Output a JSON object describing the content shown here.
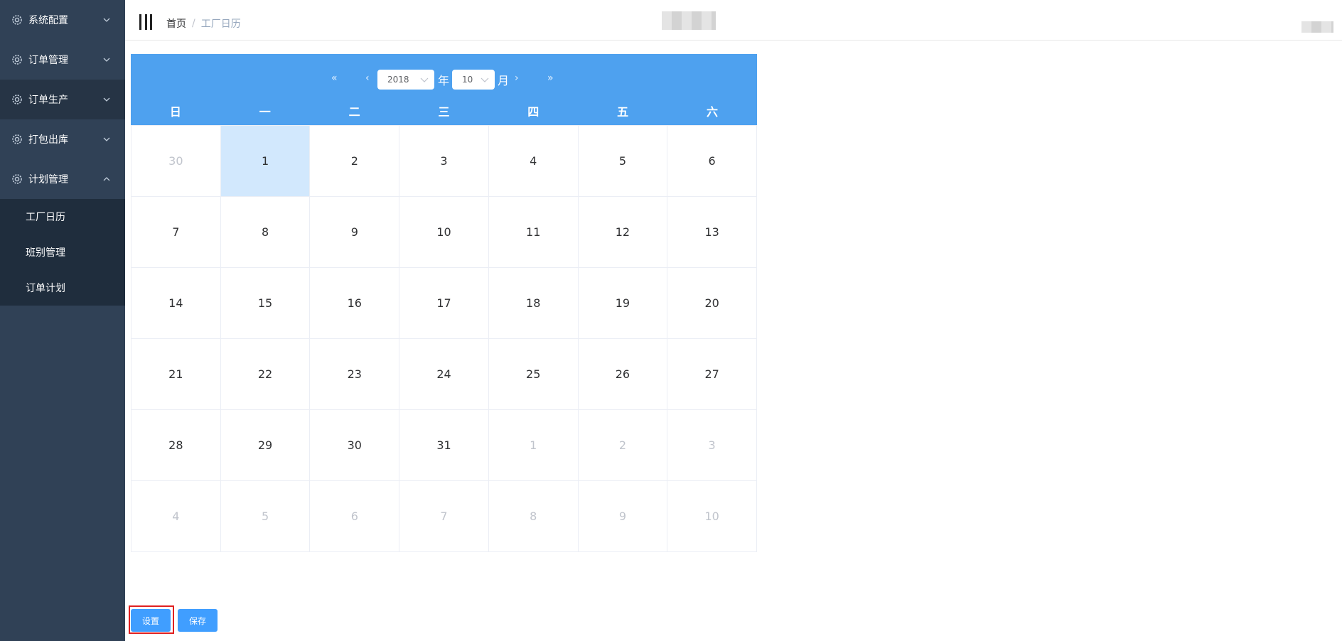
{
  "sidebar": {
    "menus": [
      {
        "label": "系统配置",
        "expanded": false
      },
      {
        "label": "订单管理",
        "expanded": false
      },
      {
        "label": "订单生产",
        "expanded": false
      },
      {
        "label": "打包出库",
        "expanded": false
      },
      {
        "label": "计划管理",
        "expanded": true
      }
    ],
    "submenu": [
      "工厂日历",
      "班别管理",
      "订单计划"
    ]
  },
  "header": {
    "breadcrumb": {
      "home": "首页",
      "separator": "/",
      "current": "工厂日历"
    }
  },
  "calendar": {
    "year": "2018",
    "month": "10",
    "year_unit": "年",
    "month_unit": "月",
    "nav": {
      "prev_year": "«",
      "prev_month": "‹",
      "next_month": "›",
      "next_year": "»"
    },
    "weekdays": [
      "日",
      "一",
      "二",
      "三",
      "四",
      "五",
      "六"
    ],
    "days": [
      {
        "d": "30",
        "muted": true
      },
      {
        "d": "1",
        "selected": true
      },
      {
        "d": "2"
      },
      {
        "d": "3"
      },
      {
        "d": "4"
      },
      {
        "d": "5"
      },
      {
        "d": "6"
      },
      {
        "d": "7"
      },
      {
        "d": "8"
      },
      {
        "d": "9"
      },
      {
        "d": "10"
      },
      {
        "d": "11"
      },
      {
        "d": "12"
      },
      {
        "d": "13"
      },
      {
        "d": "14"
      },
      {
        "d": "15"
      },
      {
        "d": "16"
      },
      {
        "d": "17"
      },
      {
        "d": "18"
      },
      {
        "d": "19"
      },
      {
        "d": "20"
      },
      {
        "d": "21"
      },
      {
        "d": "22"
      },
      {
        "d": "23"
      },
      {
        "d": "24"
      },
      {
        "d": "25"
      },
      {
        "d": "26"
      },
      {
        "d": "27"
      },
      {
        "d": "28"
      },
      {
        "d": "29"
      },
      {
        "d": "30"
      },
      {
        "d": "31"
      },
      {
        "d": "1",
        "muted": true
      },
      {
        "d": "2",
        "muted": true
      },
      {
        "d": "3",
        "muted": true
      },
      {
        "d": "4",
        "muted": true
      },
      {
        "d": "5",
        "muted": true
      },
      {
        "d": "6",
        "muted": true
      },
      {
        "d": "7",
        "muted": true
      },
      {
        "d": "8",
        "muted": true
      },
      {
        "d": "9",
        "muted": true
      },
      {
        "d": "10",
        "muted": true
      }
    ]
  },
  "actions": {
    "set_label": "设置",
    "save_label": "保存"
  },
  "colors": {
    "sidebar": "#304156",
    "calendar_header": "#4ea1ef",
    "primary": "#409eff",
    "selected_day": "#d2e8fd",
    "highlight": "#e02020"
  }
}
